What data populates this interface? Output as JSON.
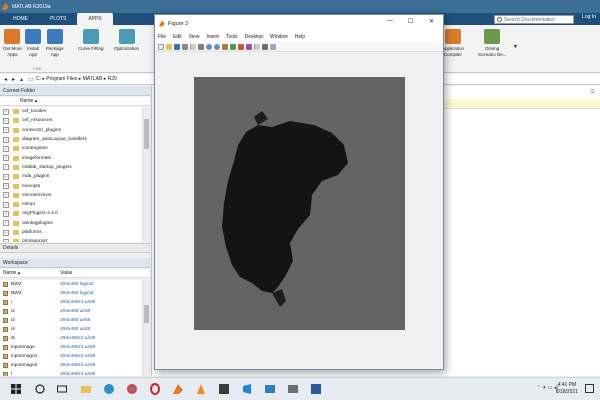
{
  "app": {
    "title": "MATLAB R2019a"
  },
  "tabs": [
    {
      "label": "HOME"
    },
    {
      "label": "PLOTS"
    },
    {
      "label": "APPS"
    }
  ],
  "search": {
    "placeholder": "Search Documentation"
  },
  "login": {
    "label": "Log In"
  },
  "ribbon": {
    "buttons": [
      {
        "label": "Get More\nApps",
        "icon": "get-more-apps-icon"
      },
      {
        "label": "Install\nApp",
        "icon": "install-app-icon"
      },
      {
        "label": "Package\nApp",
        "icon": "package-app-icon"
      },
      {
        "label": "Curve Fitting",
        "icon": "curve-fitting-icon"
      },
      {
        "label": "Optimization",
        "icon": "optimization-icon"
      },
      {
        "label": "Application\nCompiler",
        "icon": "application-compiler-icon"
      },
      {
        "label": "Driving\nScenario De...",
        "icon": "driving-scenario-icon"
      }
    ],
    "section_label": "FILE"
  },
  "address": {
    "path": "C: ▸ Program Files ▸ MATLAB ▸ R20"
  },
  "current_folder": {
    "header": "Current Folder",
    "column_name": "Name ▴",
    "items": [
      "cef_locales",
      "cef_resources",
      "connector_plugins",
      "diagram_autoLayout_handlers",
      "iconengines",
      "imageformats",
      "matlab_startup_plugins",
      "mda_plugins",
      "mexopts",
      "microservices",
      "mlmpi",
      "osgPlugins-3.4.0",
      "osintegplugins",
      "platforms",
      "printsupport"
    ]
  },
  "details": {
    "label": "Details"
  },
  "workspace": {
    "header": "Workspace",
    "col_name": "Name ▴",
    "col_value": "Value",
    "rows": [
      {
        "name": "BW2",
        "value": "494x480 logical"
      },
      {
        "name": "BW3",
        "value": "494x480 logical"
      },
      {
        "name": "i",
        "value": "494x480x3 uint8"
      },
      {
        "name": "i2",
        "value": "494x480 uint8"
      },
      {
        "name": "i3",
        "value": "494x480 uint8"
      },
      {
        "name": "i4",
        "value": "494x480 uint8"
      },
      {
        "name": "i5",
        "value": "494x480x3 uint8"
      },
      {
        "name": "inputImage",
        "value": "494x480x3 uint8"
      },
      {
        "name": "inputImage1",
        "value": "494x480x3 uint8"
      },
      {
        "name": "inputImage2",
        "value": "494x480x3 uint8"
      },
      {
        "name": "l",
        "value": "494x480x3 uint8"
      }
    ]
  },
  "figure": {
    "title": "Figure 2",
    "menu": [
      "File",
      "Edit",
      "View",
      "Insert",
      "Tools",
      "Desktop",
      "Window",
      "Help"
    ],
    "controls": {
      "minimize": "—",
      "maximize": "☐",
      "close": "✕"
    }
  },
  "taskbar": {
    "icons": [
      "windows-start-icon",
      "search-icon",
      "task-view-icon",
      "file-explorer-icon",
      "edge-icon",
      "chrome-icon",
      "opera-icon",
      "matlab-icon",
      "vlc-icon",
      "vscode-icon",
      "photos-icon",
      "word-icon"
    ],
    "time": "4:41 PM",
    "date": "8/18/2021"
  }
}
